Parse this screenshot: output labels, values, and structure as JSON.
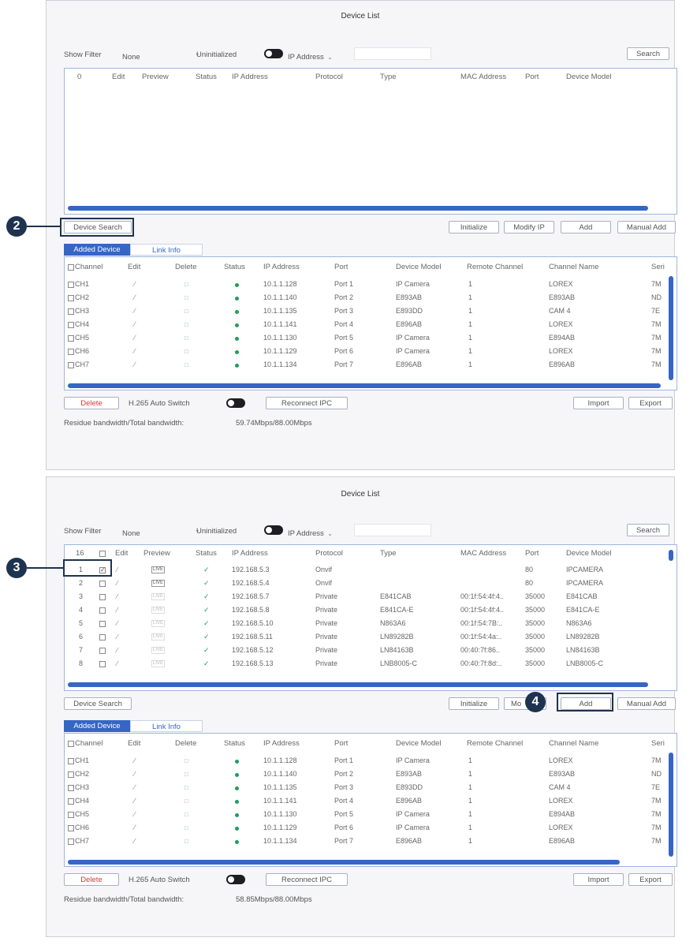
{
  "panels": [
    {
      "title": "Device List",
      "filter": {
        "label": "Show Filter",
        "value": "None",
        "uninitialized_label": "Uninitialized",
        "ip_dropdown": "IP Address",
        "search_button": "Search"
      },
      "search_table": {
        "headers": [
          "0",
          "Edit",
          "Preview",
          "Status",
          "IP Address",
          "Protocol",
          "Type",
          "MAC Address",
          "Port",
          "Device Model"
        ],
        "rows": []
      },
      "buttons": {
        "device_search": "Device Search",
        "initialize": "Initialize",
        "modify_ip": "Modify IP",
        "add": "Add",
        "manual_add": "Manual Add"
      },
      "tabs": [
        "Added Device",
        "Link Info"
      ],
      "added_table": {
        "headers": [
          "Channel",
          "Edit",
          "Delete",
          "Status",
          "IP Address",
          "Port",
          "Device Model",
          "Remote Channel",
          "Channel Name",
          "Seri"
        ],
        "rows": [
          {
            "channel": "CH1",
            "ip": "10.1.1.128",
            "port": "Port 1",
            "model": "IP Camera",
            "remote": "1",
            "name": "LOREX",
            "serial": "7M"
          },
          {
            "channel": "CH2",
            "ip": "10.1.1.140",
            "port": "Port 2",
            "model": "E893AB",
            "remote": "1",
            "name": "E893AB",
            "serial": "ND"
          },
          {
            "channel": "CH3",
            "ip": "10.1.1.135",
            "port": "Port 3",
            "model": "E893DD",
            "remote": "1",
            "name": "CAM 4",
            "serial": "7E"
          },
          {
            "channel": "CH4",
            "ip": "10.1.1.141",
            "port": "Port 4",
            "model": "E896AB",
            "remote": "1",
            "name": "LOREX",
            "serial": "7M"
          },
          {
            "channel": "CH5",
            "ip": "10.1.1.130",
            "port": "Port 5",
            "model": "IP Camera",
            "remote": "1",
            "name": "E894AB",
            "serial": "7M"
          },
          {
            "channel": "CH6",
            "ip": "10.1.1.129",
            "port": "Port 6",
            "model": "IP Camera",
            "remote": "1",
            "name": "LOREX",
            "serial": "7M"
          },
          {
            "channel": "CH7",
            "ip": "10.1.1.134",
            "port": "Port 7",
            "model": "E896AB",
            "remote": "1",
            "name": "E896AB",
            "serial": "7M"
          }
        ]
      },
      "bottom": {
        "delete": "Delete",
        "h265_label": "H.265 Auto Switch",
        "reconnect": "Reconnect IPC",
        "import": "Import",
        "export": "Export",
        "bandwidth_label": "Residue bandwidth/Total bandwidth:",
        "bandwidth_value": "59.74Mbps/88.00Mbps"
      },
      "callout": "2"
    },
    {
      "title": "Device List",
      "filter": {
        "label": "Show Filter",
        "value": "None",
        "uninitialized_label": "Uninitialized",
        "ip_dropdown": "IP Address",
        "search_button": "Search"
      },
      "search_table": {
        "headers": [
          "16",
          "",
          "Edit",
          "Preview",
          "Status",
          "IP Address",
          "Protocol",
          "Type",
          "MAC Address",
          "Port",
          "Device Model"
        ],
        "rows": [
          {
            "num": "1",
            "ip": "192.168.5.3",
            "protocol": "Onvif",
            "type": "",
            "mac": "",
            "port": "80",
            "model": "IPCAMERA",
            "checked": "true"
          },
          {
            "num": "2",
            "ip": "192.168.5.4",
            "protocol": "Onvif",
            "type": "",
            "mac": "",
            "port": "80",
            "model": "IPCAMERA",
            "checked": "false"
          },
          {
            "num": "3",
            "ip": "192.168.5.7",
            "protocol": "Private",
            "type": "E841CAB",
            "mac": "00:1f:54:4f:4..",
            "port": "35000",
            "model": "E841CAB",
            "checked": "false"
          },
          {
            "num": "4",
            "ip": "192.168.5.8",
            "protocol": "Private",
            "type": "E841CA-E",
            "mac": "00:1f:54:4f:4..",
            "port": "35000",
            "model": "E841CA-E",
            "checked": "false"
          },
          {
            "num": "5",
            "ip": "192.168.5.10",
            "protocol": "Private",
            "type": "N863A6",
            "mac": "00:1f:54:7B:..",
            "port": "35000",
            "model": "N863A6",
            "checked": "false"
          },
          {
            "num": "6",
            "ip": "192.168.5.11",
            "protocol": "Private",
            "type": "LN89282B",
            "mac": "00:1f:54:4a:..",
            "port": "35000",
            "model": "LN89282B",
            "checked": "false"
          },
          {
            "num": "7",
            "ip": "192.168.5.12",
            "protocol": "Private",
            "type": "LN84163B",
            "mac": "00:40:7f:86..",
            "port": "35000",
            "model": "LN84163B",
            "checked": "false"
          },
          {
            "num": "8",
            "ip": "192.168.5.13",
            "protocol": "Private",
            "type": "LNB8005-C",
            "mac": "00:40:7f:8d:..",
            "port": "35000",
            "model": "LNB8005-C",
            "checked": "false"
          }
        ]
      },
      "buttons": {
        "device_search": "Device Search",
        "initialize": "Initialize",
        "modify_ip": "Mo",
        "add": "Add",
        "manual_add": "Manual Add"
      },
      "tabs": [
        "Added Device",
        "Link Info"
      ],
      "added_table": {
        "headers": [
          "Channel",
          "Edit",
          "Delete",
          "Status",
          "IP Address",
          "Port",
          "Device Model",
          "Remote Channel",
          "Channel Name",
          "Seri"
        ],
        "rows": [
          {
            "channel": "CH1",
            "ip": "10.1.1.128",
            "port": "Port 1",
            "model": "IP Camera",
            "remote": "1",
            "name": "LOREX",
            "serial": "7M"
          },
          {
            "channel": "CH2",
            "ip": "10.1.1.140",
            "port": "Port 2",
            "model": "E893AB",
            "remote": "1",
            "name": "E893AB",
            "serial": "ND"
          },
          {
            "channel": "CH3",
            "ip": "10.1.1.135",
            "port": "Port 3",
            "model": "E893DD",
            "remote": "1",
            "name": "CAM 4",
            "serial": "7E"
          },
          {
            "channel": "CH4",
            "ip": "10.1.1.141",
            "port": "Port 4",
            "model": "E896AB",
            "remote": "1",
            "name": "LOREX",
            "serial": "7M"
          },
          {
            "channel": "CH5",
            "ip": "10.1.1.130",
            "port": "Port 5",
            "model": "IP Camera",
            "remote": "1",
            "name": "E894AB",
            "serial": "7M"
          },
          {
            "channel": "CH6",
            "ip": "10.1.1.129",
            "port": "Port 6",
            "model": "IP Camera",
            "remote": "1",
            "name": "LOREX",
            "serial": "7M"
          },
          {
            "channel": "CH7",
            "ip": "10.1.1.134",
            "port": "Port 7",
            "model": "E896AB",
            "remote": "1",
            "name": "E896AB",
            "serial": "7M"
          }
        ]
      },
      "bottom": {
        "delete": "Delete",
        "h265_label": "H.265 Auto Switch",
        "reconnect": "Reconnect IPC",
        "import": "Import",
        "export": "Export",
        "bandwidth_label": "Residue bandwidth/Total bandwidth:",
        "bandwidth_value": "58.85Mbps/88.00Mbps"
      },
      "callouts": [
        "3",
        "4"
      ]
    }
  ],
  "colors": {
    "accent": "#3566c4",
    "status_online": "#1e9d5a",
    "delete_text": "#d23a3a",
    "callout_badge": "#1e3350"
  }
}
